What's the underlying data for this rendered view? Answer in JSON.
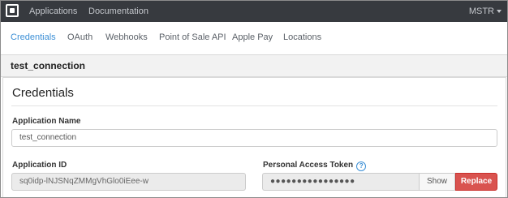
{
  "topbar": {
    "logo_icon": "square-logo-icon",
    "nav": [
      "Applications",
      "Documentation"
    ],
    "user": "MSTR",
    "background": "#373a3f"
  },
  "tabs": {
    "items": [
      "Credentials",
      "OAuth",
      "Webhooks",
      "Point of Sale API",
      "Apple Pay",
      "Locations"
    ],
    "active": "Credentials",
    "accent": "#3b8fd6"
  },
  "app": {
    "name": "test_connection"
  },
  "credentials": {
    "section_title": "Credentials",
    "application_name_label": "Application Name",
    "application_name_value": "test_connection",
    "application_id_label": "Application ID",
    "application_id_value": "sq0idp-lNJSNqZMMgVhGlo0iEee-w",
    "token_label": "Personal Access Token",
    "token_help_icon": "question-circle-icon",
    "token_masked": "●●●●●●●●●●●●●●●●",
    "show_label": "Show",
    "replace_label": "Replace",
    "replace_color": "#d9534f"
  }
}
